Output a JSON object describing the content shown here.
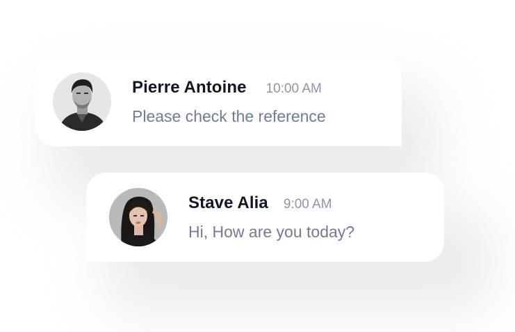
{
  "messages": [
    {
      "sender": "Pierre Antoine",
      "time": "10:00 AM",
      "text": "Please check the reference",
      "avatar": "avatar-photo-man"
    },
    {
      "sender": "Stave Alia",
      "time": "9:00 AM",
      "text": "Hi, How are you today?",
      "avatar": "avatar-photo-woman"
    }
  ],
  "colors": {
    "sender": "#0f1626",
    "time": "#8a95a8",
    "text": "#6f7c92",
    "card": "#ffffff"
  }
}
